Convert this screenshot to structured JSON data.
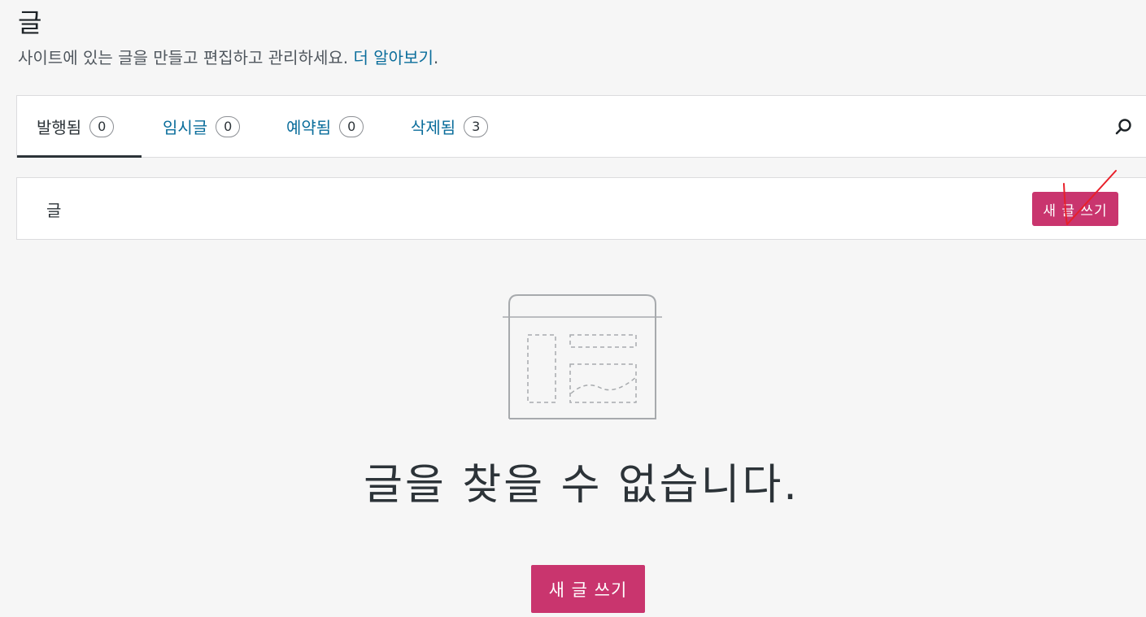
{
  "page": {
    "title": "글",
    "subtitle": "사이트에 있는 글을 만들고 편집하고 관리하세요.",
    "learn_more": "더 알아보기",
    "period": "."
  },
  "tabs": [
    {
      "label": "발행됨",
      "count": "0",
      "active": true
    },
    {
      "label": "임시글",
      "count": "0",
      "active": false
    },
    {
      "label": "예약됨",
      "count": "0",
      "active": false
    },
    {
      "label": "삭제됨",
      "count": "3",
      "active": false
    }
  ],
  "search": {
    "icon": "search-icon"
  },
  "posts_header": {
    "label": "글",
    "new_button": "새 글 쓰기"
  },
  "empty_state": {
    "illustration_icon": "empty-page-illustration-icon",
    "title": "글을 찾을 수 없습니다.",
    "new_button": "새 글 쓰기"
  },
  "colors": {
    "accent": "#c9356e",
    "link": "#0a6d9b",
    "annotation": "#e8202a"
  }
}
